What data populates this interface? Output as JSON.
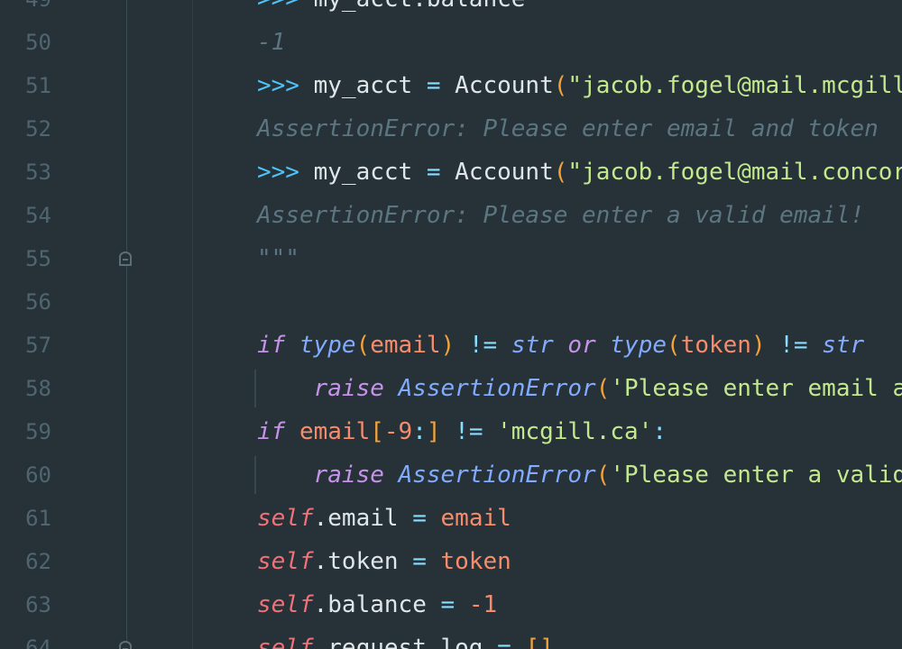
{
  "editor": {
    "lines": [
      {
        "number": "49",
        "tokens": [
          {
            "t": ">>> ",
            "c": "prompt"
          },
          {
            "t": "my_acct.balance",
            "c": "plain"
          }
        ]
      },
      {
        "number": "50",
        "tokens": [
          {
            "t": "-1",
            "c": "comment"
          }
        ]
      },
      {
        "number": "51",
        "tokens": [
          {
            "t": ">>> ",
            "c": "prompt"
          },
          {
            "t": "my_acct ",
            "c": "plain"
          },
          {
            "t": "=",
            "c": "op"
          },
          {
            "t": " Account",
            "c": "plain"
          },
          {
            "t": "(",
            "c": "paren"
          },
          {
            "t": "\"jacob.fogel@mail.mcgill.ca\"",
            "c": "str"
          }
        ]
      },
      {
        "number": "52",
        "tokens": [
          {
            "t": "AssertionError: Please enter email and token",
            "c": "comment"
          }
        ]
      },
      {
        "number": "53",
        "tokens": [
          {
            "t": ">>> ",
            "c": "prompt"
          },
          {
            "t": "my_acct ",
            "c": "plain"
          },
          {
            "t": "=",
            "c": "op"
          },
          {
            "t": " Account",
            "c": "plain"
          },
          {
            "t": "(",
            "c": "paren"
          },
          {
            "t": "\"jacob.fogel@mail.concordia.ca\"",
            "c": "str"
          }
        ]
      },
      {
        "number": "54",
        "tokens": [
          {
            "t": "AssertionError: Please enter a valid email!",
            "c": "comment"
          }
        ]
      },
      {
        "number": "55",
        "tokens": [
          {
            "t": "\"\"\"",
            "c": "comment"
          }
        ]
      },
      {
        "number": "56",
        "tokens": []
      },
      {
        "number": "57",
        "tokens": [
          {
            "t": "if",
            "c": "kw"
          },
          {
            "t": " ",
            "c": "plain"
          },
          {
            "t": "type",
            "c": "builtin"
          },
          {
            "t": "(",
            "c": "paren"
          },
          {
            "t": "email",
            "c": "var"
          },
          {
            "t": ")",
            "c": "paren"
          },
          {
            "t": " != ",
            "c": "op"
          },
          {
            "t": "str",
            "c": "builtin"
          },
          {
            "t": " or ",
            "c": "kw"
          },
          {
            "t": "type",
            "c": "builtin"
          },
          {
            "t": "(",
            "c": "paren"
          },
          {
            "t": "token",
            "c": "var"
          },
          {
            "t": ")",
            "c": "paren"
          },
          {
            "t": " != ",
            "c": "op"
          },
          {
            "t": "str",
            "c": "builtin"
          }
        ]
      },
      {
        "number": "58",
        "tokens": [
          {
            "t": "    ",
            "c": "plain"
          },
          {
            "t": "raise",
            "c": "kw"
          },
          {
            "t": " ",
            "c": "plain"
          },
          {
            "t": "AssertionError",
            "c": "builtin"
          },
          {
            "t": "(",
            "c": "paren"
          },
          {
            "t": "'Please enter email and token'",
            "c": "str"
          }
        ]
      },
      {
        "number": "59",
        "tokens": [
          {
            "t": "if",
            "c": "kw"
          },
          {
            "t": " ",
            "c": "plain"
          },
          {
            "t": "email",
            "c": "var"
          },
          {
            "t": "[",
            "c": "paren"
          },
          {
            "t": "-9",
            "c": "num"
          },
          {
            "t": ":",
            "c": "op"
          },
          {
            "t": "]",
            "c": "paren"
          },
          {
            "t": " != ",
            "c": "op"
          },
          {
            "t": "'mcgill.ca'",
            "c": "str"
          },
          {
            "t": ":",
            "c": "op"
          }
        ]
      },
      {
        "number": "60",
        "tokens": [
          {
            "t": "    ",
            "c": "plain"
          },
          {
            "t": "raise",
            "c": "kw"
          },
          {
            "t": " ",
            "c": "plain"
          },
          {
            "t": "AssertionError",
            "c": "builtin"
          },
          {
            "t": "(",
            "c": "paren"
          },
          {
            "t": "'Please enter a valid email!'",
            "c": "str"
          }
        ]
      },
      {
        "number": "61",
        "tokens": [
          {
            "t": "self",
            "c": "self"
          },
          {
            "t": ".email ",
            "c": "plain"
          },
          {
            "t": "=",
            "c": "op"
          },
          {
            "t": " ",
            "c": "plain"
          },
          {
            "t": "email",
            "c": "var"
          }
        ]
      },
      {
        "number": "62",
        "tokens": [
          {
            "t": "self",
            "c": "self"
          },
          {
            "t": ".token ",
            "c": "plain"
          },
          {
            "t": "=",
            "c": "op"
          },
          {
            "t": " ",
            "c": "plain"
          },
          {
            "t": "token",
            "c": "var"
          }
        ]
      },
      {
        "number": "63",
        "tokens": [
          {
            "t": "self",
            "c": "self"
          },
          {
            "t": ".balance ",
            "c": "plain"
          },
          {
            "t": "=",
            "c": "op"
          },
          {
            "t": " ",
            "c": "plain"
          },
          {
            "t": "-1",
            "c": "num"
          }
        ]
      },
      {
        "number": "64",
        "tokens": [
          {
            "t": "self",
            "c": "self"
          },
          {
            "t": ".request_log ",
            "c": "plain"
          },
          {
            "t": "=",
            "c": "op"
          },
          {
            "t": " ",
            "c": "plain"
          },
          {
            "t": "[]",
            "c": "paren"
          }
        ]
      }
    ],
    "fold_line_indices": [
      6,
      15
    ],
    "indent_guide_line_indices": [
      9,
      11
    ]
  }
}
